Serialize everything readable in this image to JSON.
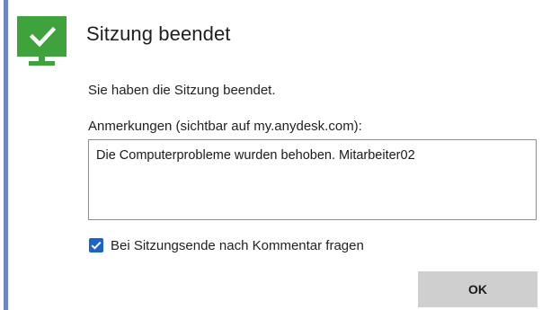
{
  "dialog": {
    "title": "Sitzung beendet",
    "message": "Sie haben die Sitzung beendet.",
    "status_icon": "monitor-check-icon",
    "accent_color": "#6a85c8",
    "icon_color": "#3ea33c"
  },
  "notes": {
    "label": "Anmerkungen (sichtbar auf my.anydesk.com):",
    "value": "Die Computerprobleme wurden behoben. Mitarbeiter02"
  },
  "ask_comment": {
    "label": "Bei Sitzungsende nach Kommentar fragen",
    "checked": true,
    "color": "#1c63c7"
  },
  "buttons": {
    "ok_label": "OK"
  }
}
